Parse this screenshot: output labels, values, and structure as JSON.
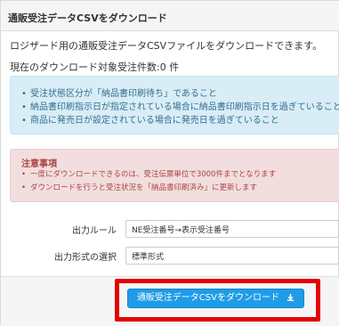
{
  "panel": {
    "title": "通販受注データCSVをダウンロード"
  },
  "intro": "ロジザード用の通販受注データCSVファイルをダウンロードできます。",
  "count_text": "現在のダウンロード対象受注件数:0 件",
  "info_items": [
    "受注状態区分が「納品書印刷待ち」であること",
    "納品書印刷指示日が指定されている場合に納品書印刷指示日を過ぎていること",
    "商品に発売日が設定されている場合に発売日を過ぎていること"
  ],
  "warning": {
    "title": "注意事項",
    "items": [
      "一度にダウンロードできるのは、受注伝票単位で3000件までとなります",
      "ダウンロードを行うと受注状況を「納品書印刷済み」に更新します"
    ]
  },
  "form": {
    "output_rule_label": "出力ルール",
    "output_rule_value": "NE受注番号→表示受注番号",
    "output_format_label": "出力形式の選択",
    "output_format_value": "標準形式"
  },
  "download_button": {
    "label": "通販受注データCSVをダウンロード",
    "icon": "download-icon"
  },
  "colors": {
    "info_bg": "#d9edf7",
    "warning_bg": "#f2dede",
    "button": "#1e9ce8",
    "highlight": "#e30000"
  }
}
